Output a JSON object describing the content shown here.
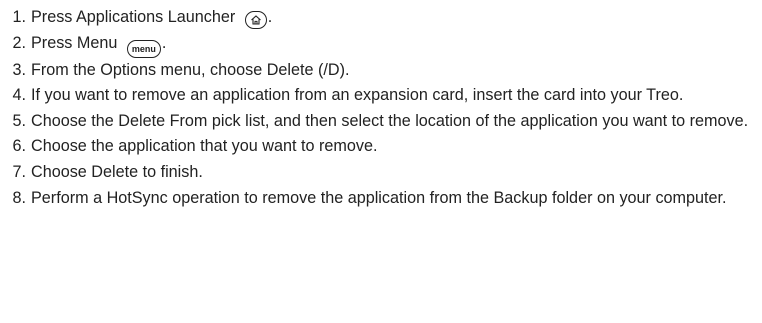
{
  "steps": [
    {
      "number": "1",
      "text": "Press Applications Launcher",
      "icon": "home-icon",
      "after": "."
    },
    {
      "number": "2",
      "text": "Press Menu",
      "icon": "menu-key-icon",
      "icon_label": "menu",
      "after": "."
    },
    {
      "number": "3",
      "text": "From the Options menu, choose Delete (/D)."
    },
    {
      "number": "4",
      "text": "If you want to remove an application from an expansion card, insert the card into your Treo."
    },
    {
      "number": "5",
      "text": "Choose the Delete From pick list, and then select the location of the application you want to remove."
    },
    {
      "number": "6",
      "text": "Choose the application that you want to remove."
    },
    {
      "number": "7",
      "text": "Choose Delete to finish."
    },
    {
      "number": "8",
      "text": "Perform a HotSync operation to remove the application from the Backup folder on your computer."
    }
  ]
}
